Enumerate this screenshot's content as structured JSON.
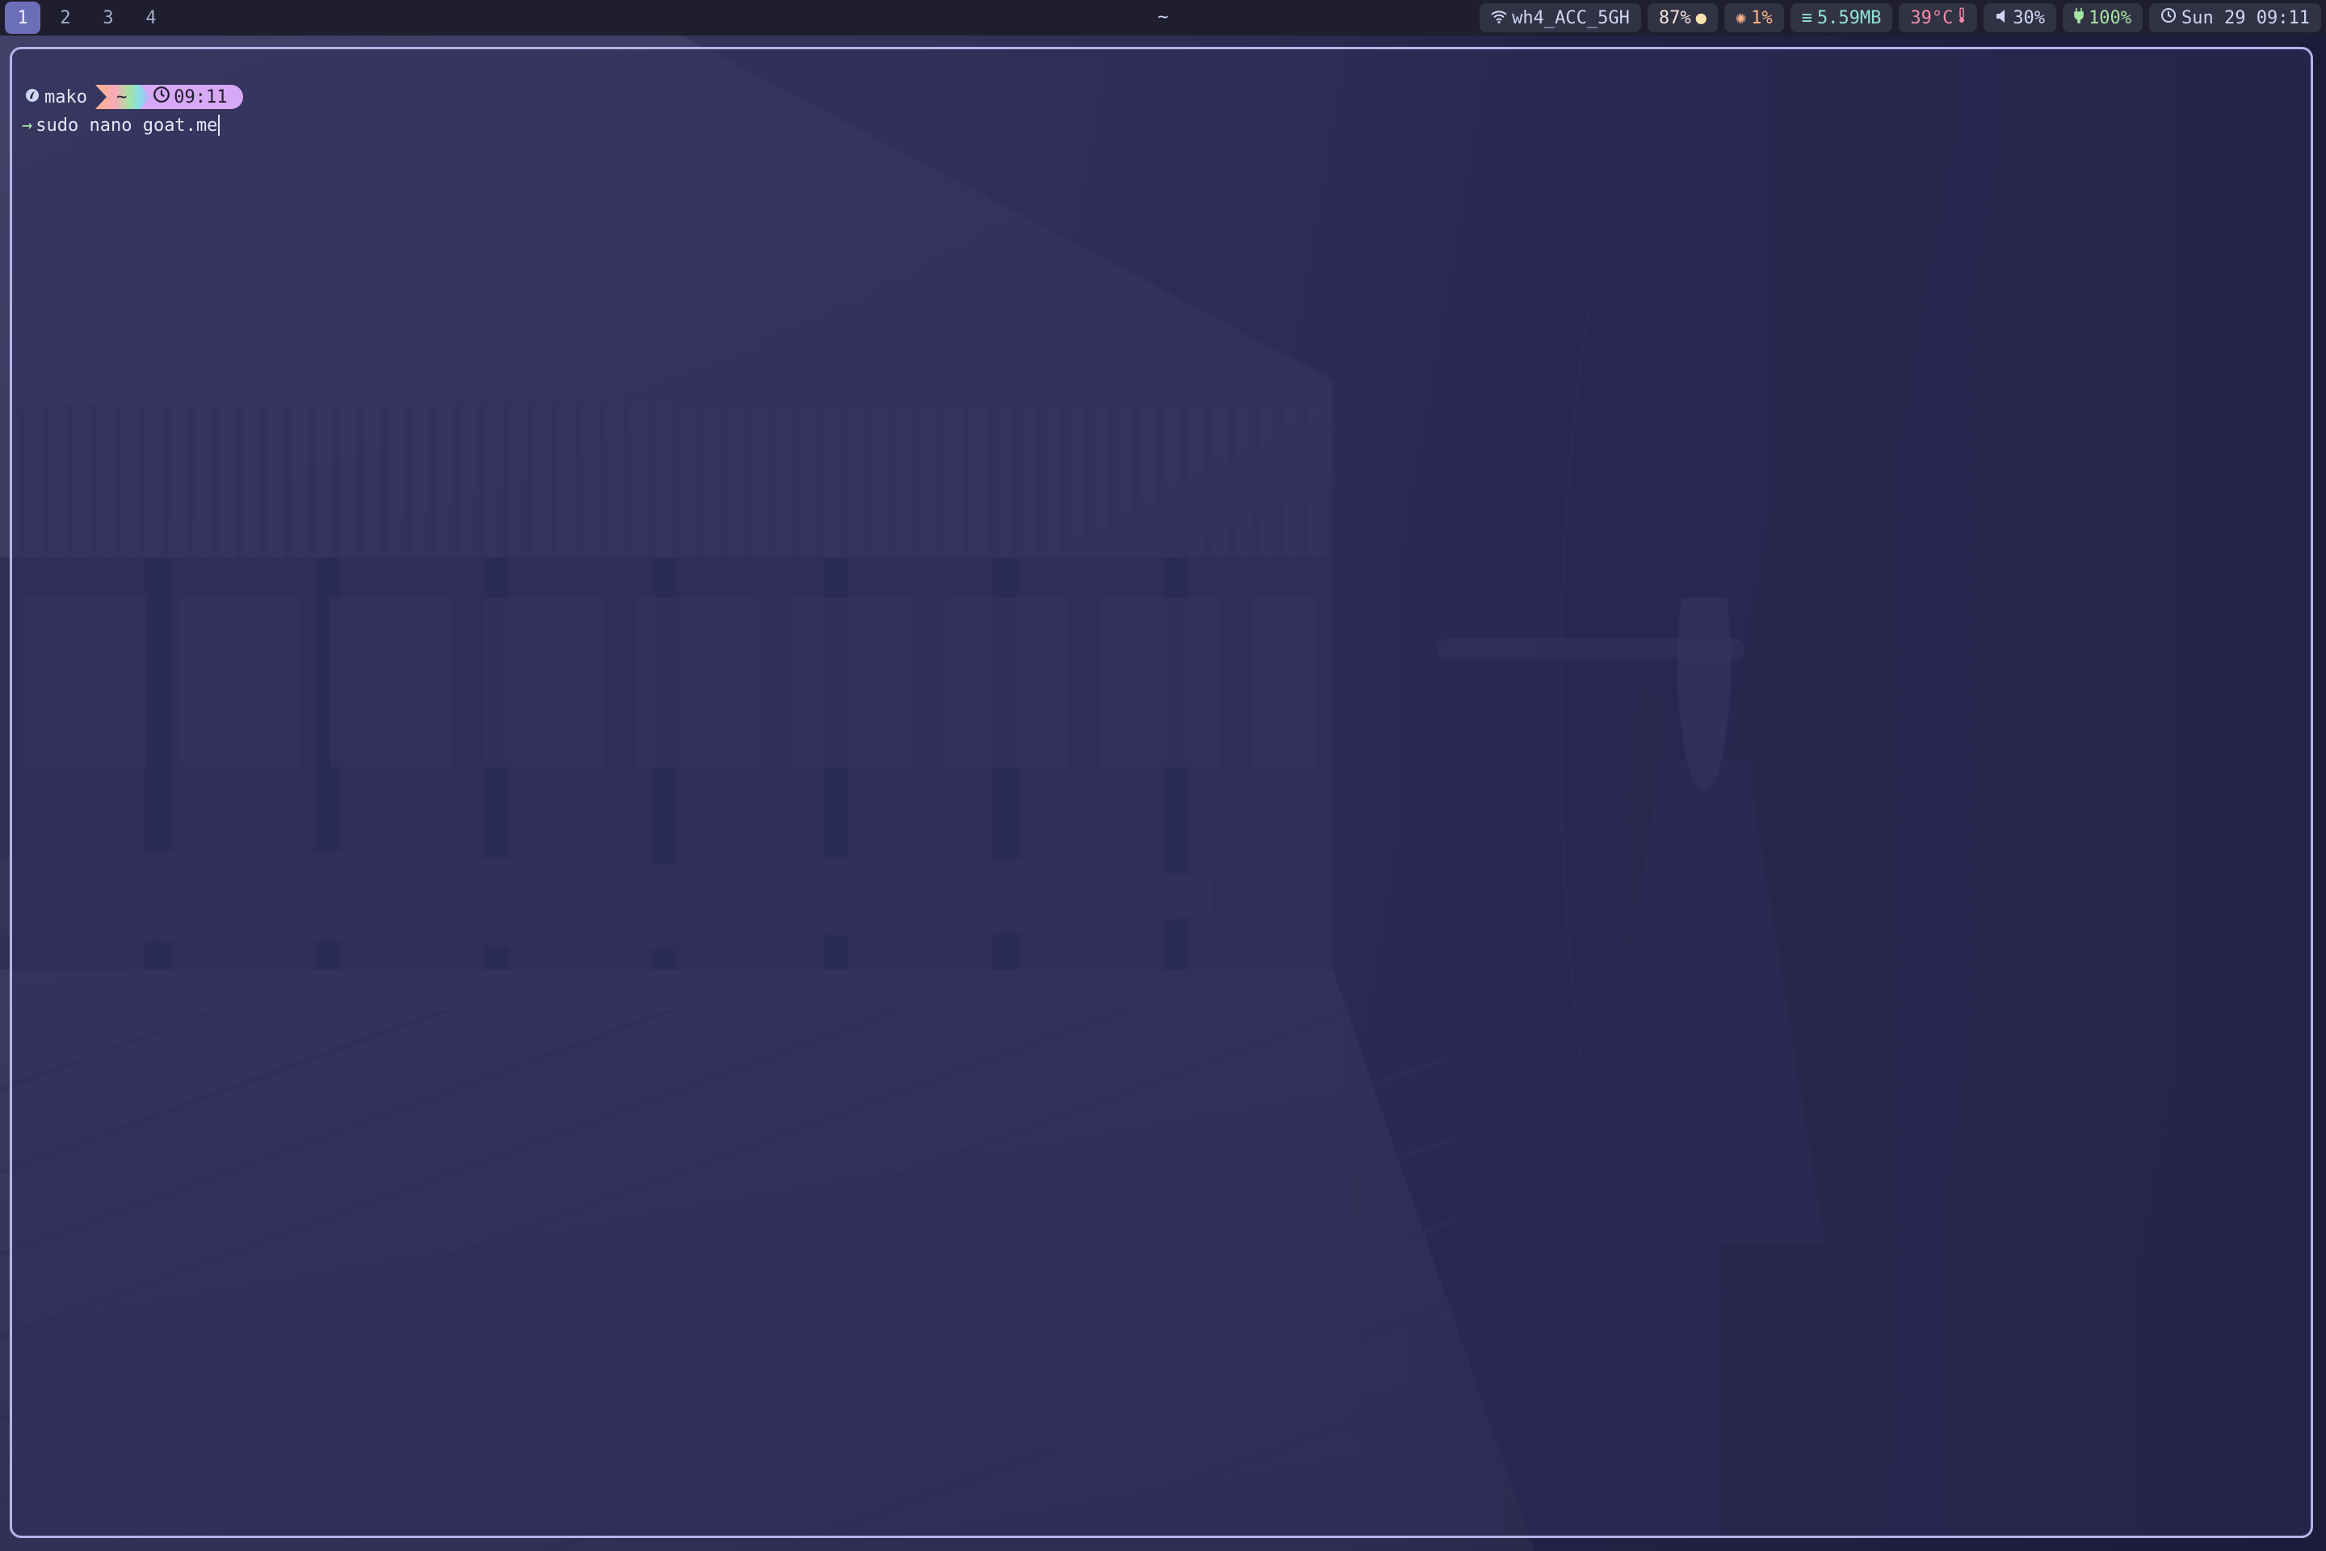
{
  "workspaces": [
    "1",
    "2",
    "3",
    "4"
  ],
  "active_workspace": "1",
  "window_title": "~",
  "status": {
    "wifi": "wh4_ACC_5GH",
    "brightness": "87%",
    "cpu": "1%",
    "memory": "5.59MB",
    "temperature": "39°C",
    "volume": "30%",
    "battery": "100%",
    "clock": "Sun 29 09:11"
  },
  "terminal": {
    "user": "mako",
    "directory": "~",
    "time": "09:11",
    "command": "sudo nano goat.me"
  },
  "colors": {
    "accent": "#6c6fb8",
    "border": "#b4b4ea",
    "prompt_time_bg": "#d7a8f5",
    "arrow": "#a6e3a1"
  },
  "icons": {
    "wifi": "wifi-icon",
    "brightness": "brightness-icon",
    "cpu": "cpu-icon",
    "memory": "memory-icon",
    "temperature": "thermometer-icon",
    "volume": "volume-icon",
    "battery": "battery-icon",
    "clock": "clock-icon",
    "user": "user-icon"
  }
}
